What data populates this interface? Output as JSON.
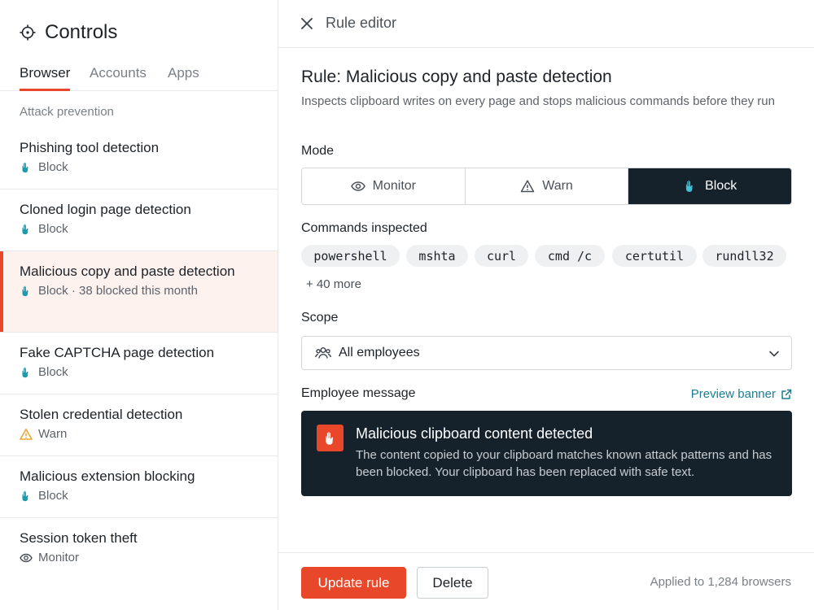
{
  "sidebar": {
    "title": "Controls",
    "tabs": [
      {
        "label": "Browser",
        "active": true
      },
      {
        "label": "Accounts",
        "active": false
      },
      {
        "label": "Apps",
        "active": false
      }
    ],
    "section_label": "Attack prevention",
    "rules": [
      {
        "name": "Phishing tool detection",
        "status": "Block",
        "status_icon": "hand-icon",
        "selected": false
      },
      {
        "name": "Cloned login page detection",
        "status": "Block",
        "status_icon": "hand-icon",
        "selected": false
      },
      {
        "name": "Malicious copy and paste detection",
        "status": "Block · 38 blocked this month",
        "status_icon": "hand-icon",
        "selected": true
      },
      {
        "name": "Fake CAPTCHA page detection",
        "status": "Block",
        "status_icon": "hand-icon",
        "selected": false
      },
      {
        "name": "Stolen credential detection",
        "status": "Warn",
        "status_icon": "warning-icon",
        "selected": false
      },
      {
        "name": "Malicious extension blocking",
        "status": "Block",
        "status_icon": "hand-icon",
        "selected": false
      },
      {
        "name": "Session token theft",
        "status": "Monitor",
        "status_icon": "eye-icon",
        "selected": false
      }
    ]
  },
  "editor": {
    "panel_title": "Rule editor",
    "rule_title": "Rule: Malicious copy and paste detection",
    "description": "Inspects clipboard writes on every page and stops malicious commands before they run",
    "mode_label": "Mode",
    "modes": [
      {
        "label": "Monitor",
        "icon": "eye-icon",
        "active": false
      },
      {
        "label": "Warn",
        "icon": "warning-icon",
        "active": false
      },
      {
        "label": "Block",
        "icon": "hand-icon",
        "active": true
      }
    ],
    "commands_label": "Commands inspected",
    "commands": [
      "powershell",
      "mshta",
      "curl",
      "cmd /c",
      "certutil",
      "rundll32"
    ],
    "more_commands": "+ 40 more",
    "scope_label": "Scope",
    "scope_value": "All employees",
    "message_label": "Employee message",
    "preview_link": "Preview banner",
    "banner_title": "Malicious clipboard content detected",
    "banner_body": "The content copied to your clipboard matches known attack patterns and has been blocked. Your clipboard has been replaced with safe text.",
    "update_button": "Update rule",
    "delete_button": "Delete",
    "applied_text": "Applied to 1,284 browsers"
  },
  "colors": {
    "accent": "#e8472a",
    "dark": "#16222b",
    "block_icon": "#1a9bb0",
    "warn_icon": "#e8a530",
    "link": "#1a7e93"
  }
}
